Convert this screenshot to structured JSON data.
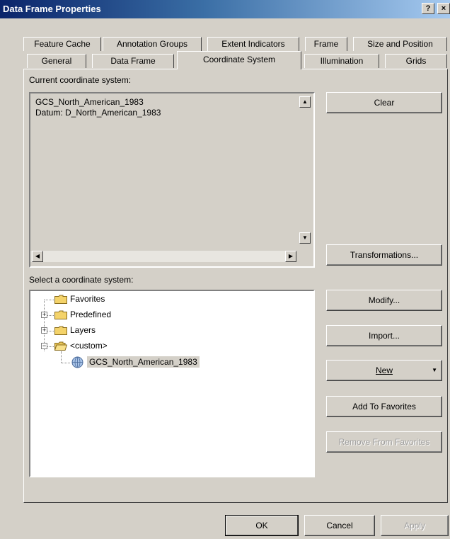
{
  "window": {
    "title": "Data Frame Properties",
    "help_glyph": "?",
    "close_glyph": "×"
  },
  "tabs": {
    "row1": [
      "Feature Cache",
      "Annotation Groups",
      "Extent Indicators",
      "Frame",
      "Size and Position"
    ],
    "row2": [
      "General",
      "Data Frame",
      "Coordinate System",
      "Illumination",
      "Grids"
    ],
    "active": "Coordinate System"
  },
  "current": {
    "label": "Current coordinate system:",
    "line1": "GCS_North_American_1983",
    "line2": "Datum: D_North_American_1983"
  },
  "select": {
    "label": "Select a coordinate system:"
  },
  "tree": {
    "items": [
      "Favorites",
      "Predefined",
      "Layers",
      "<custom>",
      "GCS_North_American_1983"
    ],
    "selected": "GCS_North_American_1983"
  },
  "buttons": {
    "clear": "Clear",
    "transformations": "Transformations...",
    "modify": "Modify...",
    "import": "Import...",
    "new": "New",
    "add_favorites": "Add To Favorites",
    "remove_favorites": "Remove From Favorites",
    "ok": "OK",
    "cancel": "Cancel",
    "apply": "Apply"
  },
  "colors": {
    "title_bar": "#0a246a",
    "face": "#d4d0c8",
    "selection": "#d4d0c8"
  }
}
